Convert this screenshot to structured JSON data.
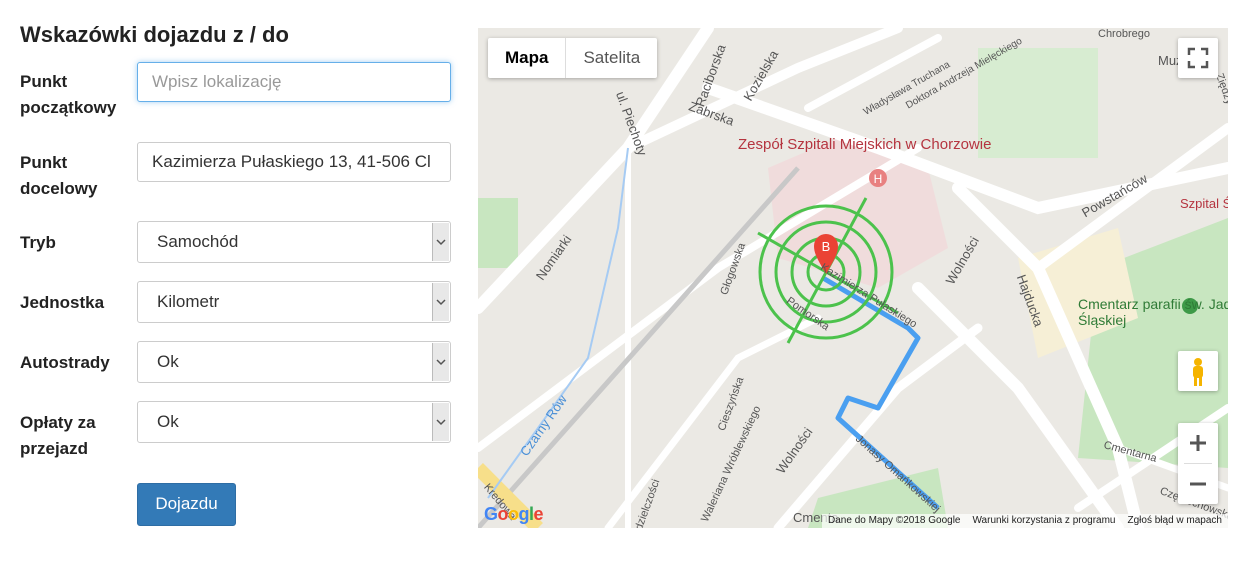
{
  "form": {
    "title": "Wskazówki dojazdu z / do",
    "start_label": "Punkt początkowy",
    "start_placeholder": "Wpisz lokalizację",
    "end_label": "Punkt docelowy",
    "end_value": "Kazimierza Pułaskiego 13, 41-506 Cl",
    "mode_label": "Tryb",
    "mode_value": "Samochód",
    "unit_label": "Jednostka",
    "unit_value": "Kilometr",
    "highways_label": "Autostrady",
    "highways_value": "Ok",
    "tolls_label": "Opłaty za przejazd",
    "tolls_value": "Ok",
    "submit_label": "Dojazdu"
  },
  "map": {
    "type_map": "Mapa",
    "type_satellite": "Satelita",
    "marker_letter": "B",
    "google_logo": "Google",
    "attribution": [
      "Dane do Mapy ©2018 Google",
      "Warunki korzystania z programu",
      "Zgłoś błąd w mapach"
    ],
    "poi_hospital": "Zespół Szpitali Miejskich w Chorzowie",
    "poi_cemetery": "Cmentarz parafii św. Jadwigi Śląskiej",
    "streets": [
      "Raciborska",
      "Kozielska",
      "Zabrska",
      "ul. Piechoty",
      "Nomiarki",
      "Czarny Rów",
      "Głogowska",
      "Pomorska",
      "Kazimierza Pułaskiego",
      "Wolności",
      "Hajducka",
      "Powstańców",
      "Cieszyńska",
      "Waleriana Wróblewskiego",
      "Jonasy Omańkowskiej",
      "Władysława Truchana",
      "Doktora Andrzeja Mielęckiego",
      "Cmentarna",
      "Częstochowska",
      "Spódzielczości",
      "Kredowa",
      "Szpital Ś",
      "Muz",
      "Ziędzy",
      "Chrobrego",
      "Cmenta"
    ],
    "colors": {
      "route": "#4a9ff0",
      "marker": "#ea4335",
      "park": "#c8e6c0",
      "hospital": "#f0dcdc",
      "road": "#ffffff"
    }
  }
}
